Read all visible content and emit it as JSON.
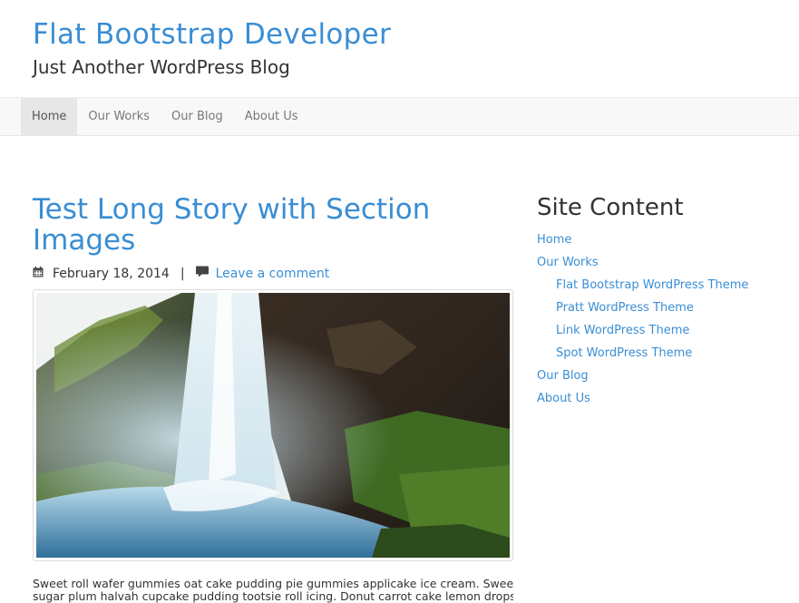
{
  "header": {
    "site_title": "Flat Bootstrap Developer",
    "tagline": "Just Another WordPress Blog"
  },
  "nav": {
    "items": [
      {
        "label": "Home",
        "active": true
      },
      {
        "label": "Our Works",
        "active": false
      },
      {
        "label": "Our Blog",
        "active": false
      },
      {
        "label": "About Us",
        "active": false
      }
    ]
  },
  "post": {
    "title": "Test Long Story with Section Images",
    "date": "February 18, 2014",
    "separator": "|",
    "comment_link": "Leave a comment",
    "date_icon": "calendar-icon",
    "comment_icon": "comment-icon",
    "excerpt_line1": "Sweet roll wafer gummies oat cake pudding pie gummies applicake ice cream. Sweet",
    "excerpt_line2": "sugar plum halvah cupcake pudding tootsie roll icing. Donut carrot cake lemon drops"
  },
  "sidebar": {
    "widget_title": "Site Content",
    "links": [
      {
        "label": "Home",
        "level": 0
      },
      {
        "label": "Our Works",
        "level": 0
      },
      {
        "label": "Flat Bootstrap WordPress Theme",
        "level": 1
      },
      {
        "label": "Pratt WordPress Theme",
        "level": 1
      },
      {
        "label": "Link WordPress Theme",
        "level": 1
      },
      {
        "label": "Spot WordPress Theme",
        "level": 1
      },
      {
        "label": "Our Blog",
        "level": 0
      },
      {
        "label": "About Us",
        "level": 0
      }
    ]
  },
  "colors": {
    "link": "#3a8ed4",
    "text": "#333333",
    "nav_bg": "#f8f8f8",
    "nav_active_bg": "#e7e7e7"
  }
}
